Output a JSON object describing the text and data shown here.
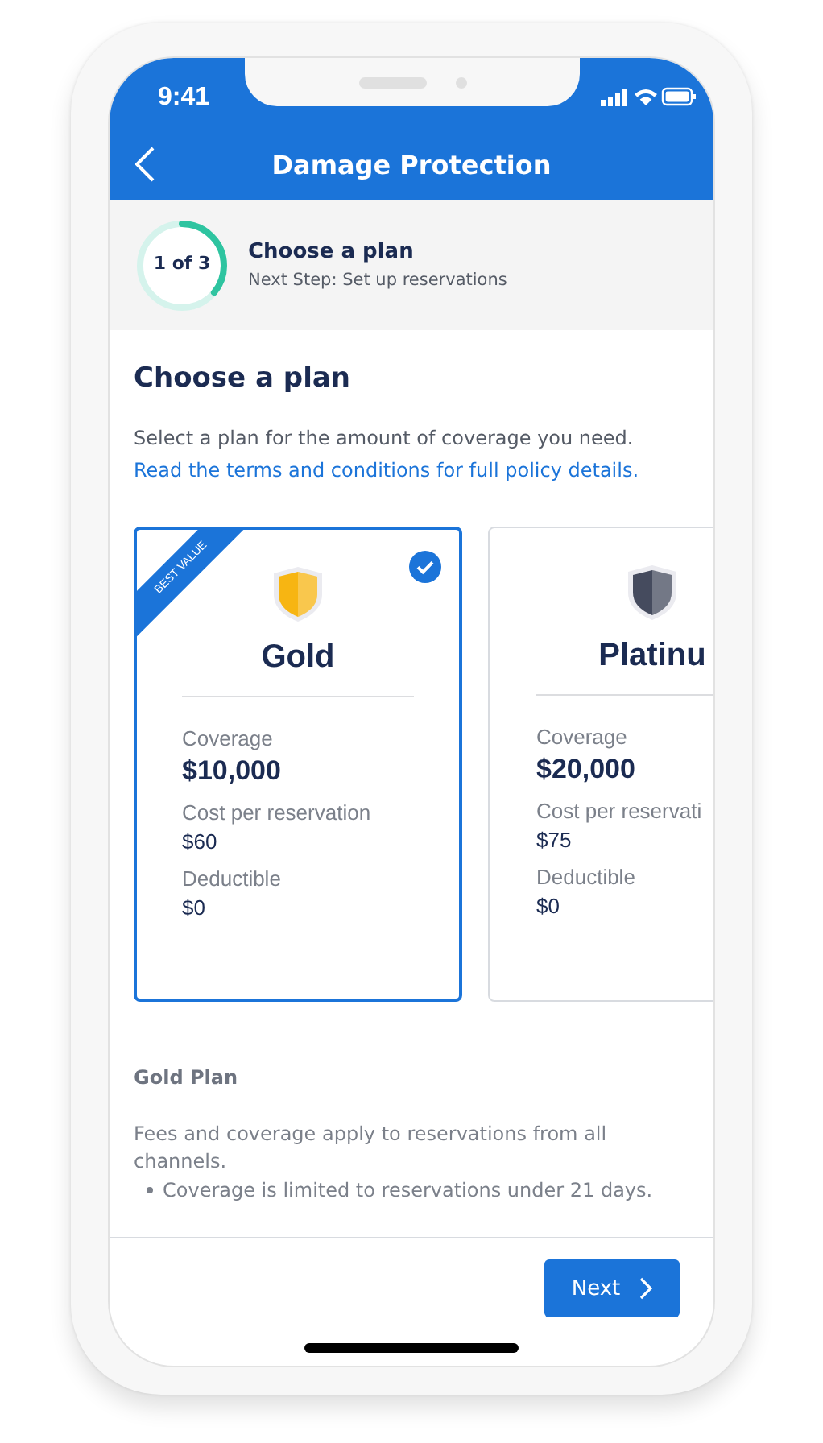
{
  "status_bar": {
    "time": "9:41"
  },
  "nav": {
    "title": "Damage Protection"
  },
  "step": {
    "counter": "1 of 3",
    "level": 0.36,
    "title": "Choose a plan",
    "subtitle": "Next Step: Set up reservations"
  },
  "heading": "Choose a plan",
  "intro": "Select a plan for the amount of coverage you need.",
  "link": "Read the terms and conditions for full policy details.",
  "plans": [
    {
      "name": "Gold",
      "selected": true,
      "ribbon": "BEST VALUE",
      "color": "#f7b512",
      "rows": [
        {
          "label": "Coverage",
          "value": "$10,000",
          "kind": "large"
        },
        {
          "label": "Cost per reservation",
          "value": "$60",
          "kind": "normal"
        },
        {
          "label": "Deductible",
          "value": "$0",
          "kind": "normal"
        }
      ]
    },
    {
      "name": "Platinu",
      "selected": false,
      "color": "#454b5e",
      "rows": [
        {
          "label": "Coverage",
          "value": "$20,000",
          "kind": "large"
        },
        {
          "label": "Cost per reservati",
          "value": "$75",
          "kind": "normal"
        },
        {
          "label": "Deductible",
          "value": "$0",
          "kind": "normal"
        }
      ]
    }
  ],
  "details": {
    "title": "Gold Plan",
    "text": "Fees and coverage apply to reservations from all channels.",
    "bullets": [
      "Coverage is limited to reservations under 21 days."
    ]
  },
  "footer": {
    "button": "Next"
  }
}
